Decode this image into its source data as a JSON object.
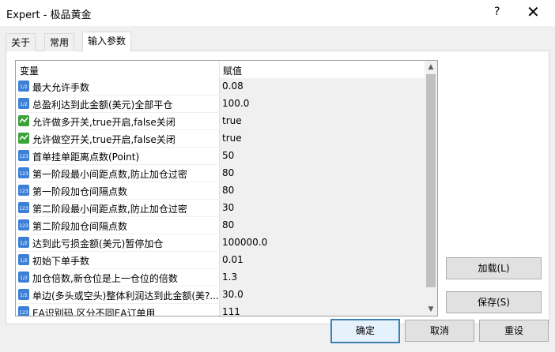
{
  "window": {
    "title": "Expert - 极品黄金",
    "help_label": "?",
    "close_label": "✕"
  },
  "tabs": [
    {
      "label": "关于",
      "active": false
    },
    {
      "label": "常用",
      "active": false
    },
    {
      "label": "输入参数",
      "active": true
    }
  ],
  "grid": {
    "col_variable": "变量",
    "col_value": "赋值",
    "rows": [
      {
        "icon": "decimal-icon",
        "name": "最大允许手数",
        "value": "0.08"
      },
      {
        "icon": "decimal-icon",
        "name": "总盈利达到此金额(美元)全部平仓",
        "value": "100.0"
      },
      {
        "icon": "boolean-icon",
        "name": "允许做多开关,true开启,false关闭",
        "value": "true"
      },
      {
        "icon": "boolean-icon",
        "name": "允许做空开关,true开启,false关闭",
        "value": "true"
      },
      {
        "icon": "integer-icon",
        "name": "首单挂单距离点数(Point)",
        "value": "50"
      },
      {
        "icon": "integer-icon",
        "name": "第一阶段最小间距点数,防止加仓过密",
        "value": "80"
      },
      {
        "icon": "integer-icon",
        "name": "第一阶段加仓间隔点数",
        "value": "80"
      },
      {
        "icon": "integer-icon",
        "name": "第二阶段最小间距点数,防止加仓过密",
        "value": "30"
      },
      {
        "icon": "integer-icon",
        "name": "第二阶段加仓间隔点数",
        "value": "80"
      },
      {
        "icon": "decimal-icon",
        "name": "达到此亏损金额(美元)暂停加仓",
        "value": "100000.0"
      },
      {
        "icon": "decimal-icon",
        "name": "初始下单手数",
        "value": "0.01"
      },
      {
        "icon": "decimal-icon",
        "name": "加仓倍数,新仓位是上一仓位的倍数",
        "value": "1.3"
      },
      {
        "icon": "decimal-icon",
        "name": "单边(多头或空头)整体利润达到此金额(美?...",
        "value": "30.0"
      },
      {
        "icon": "integer-icon",
        "name": "EA识别码,区分不同EA订单用",
        "value": "111"
      }
    ]
  },
  "side_buttons": {
    "load_label": "加载(L)",
    "save_label": "保存(S)"
  },
  "footer_buttons": {
    "ok_label": "确定",
    "cancel_label": "取消",
    "reset_label": "重设"
  },
  "colors": {
    "accent": "#3c7fb1",
    "selected_bg": "#e5f1fb"
  }
}
